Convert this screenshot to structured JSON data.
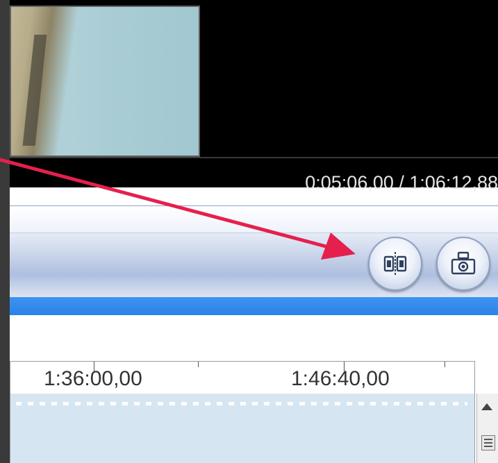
{
  "preview": {
    "time_readout": "0:05:06,00 / 1:06:12,88"
  },
  "toolbar": {
    "buttons": [
      {
        "name": "split-clip",
        "icon": "split-icon"
      },
      {
        "name": "take-snapshot",
        "icon": "camera-icon"
      }
    ]
  },
  "timeline": {
    "ruler_labels": [
      "1:36:00,00",
      "1:46:40,00"
    ]
  },
  "colors": {
    "annotation_arrow": "#e5204d",
    "selection_band": "#2a83ea",
    "track_background": "#d6e5f2"
  }
}
